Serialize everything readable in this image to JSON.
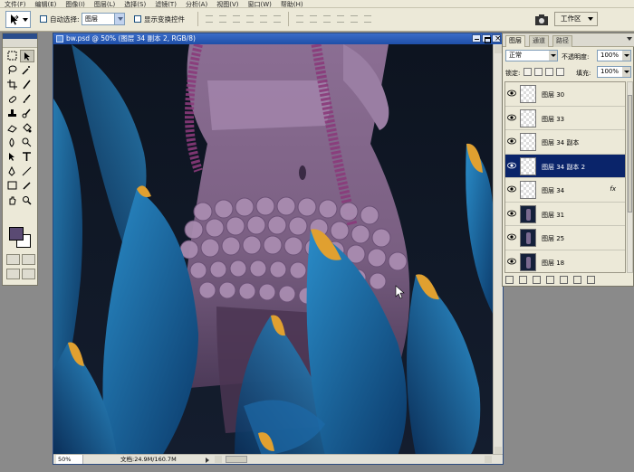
{
  "menu": [
    "文件(F)",
    "编辑(E)",
    "图像(I)",
    "图层(L)",
    "选择(S)",
    "滤镜(T)",
    "分析(A)",
    "视图(V)",
    "窗口(W)",
    "帮助(H)"
  ],
  "options": {
    "auto_select_label": "自动选择:",
    "auto_select_value": "图层",
    "show_transform_label": "显示变换控件",
    "workspace_label": "工作区"
  },
  "document": {
    "title": "bw.psd @ 50% (图层 34 副本 2, RGB/8)",
    "zoom": "50%",
    "doc_info": "文档:24.9M/160.7M"
  },
  "layers_panel": {
    "tabs": [
      "图层",
      "通道",
      "路径"
    ],
    "blend_mode": "正常",
    "opacity_label": "不透明度:",
    "opacity_value": "100%",
    "lock_label": "锁定:",
    "fill_label": "填充:",
    "fill_value": "100%",
    "layers": [
      {
        "name": "图层 30",
        "thumb": "transparent",
        "selected": false,
        "fx": ""
      },
      {
        "name": "图层 33",
        "thumb": "transparent",
        "selected": false,
        "fx": ""
      },
      {
        "name": "图层 34 副本",
        "thumb": "transparent",
        "selected": false,
        "fx": ""
      },
      {
        "name": "图层 34 副本 2",
        "thumb": "transparent",
        "selected": true,
        "fx": ""
      },
      {
        "name": "图层 34",
        "thumb": "transparent",
        "selected": false,
        "fx": "fx"
      },
      {
        "name": "图层 31",
        "thumb": "art",
        "selected": false,
        "fx": ""
      },
      {
        "name": "图层 25",
        "thumb": "art",
        "selected": false,
        "fx": ""
      },
      {
        "name": "图层 18",
        "thumb": "art",
        "selected": false,
        "fx": ""
      }
    ]
  },
  "colors": {
    "foreground": "#5a4a73",
    "background": "#ffffff",
    "selection": "#0a246a",
    "titlebar": "#2a5cb8"
  }
}
